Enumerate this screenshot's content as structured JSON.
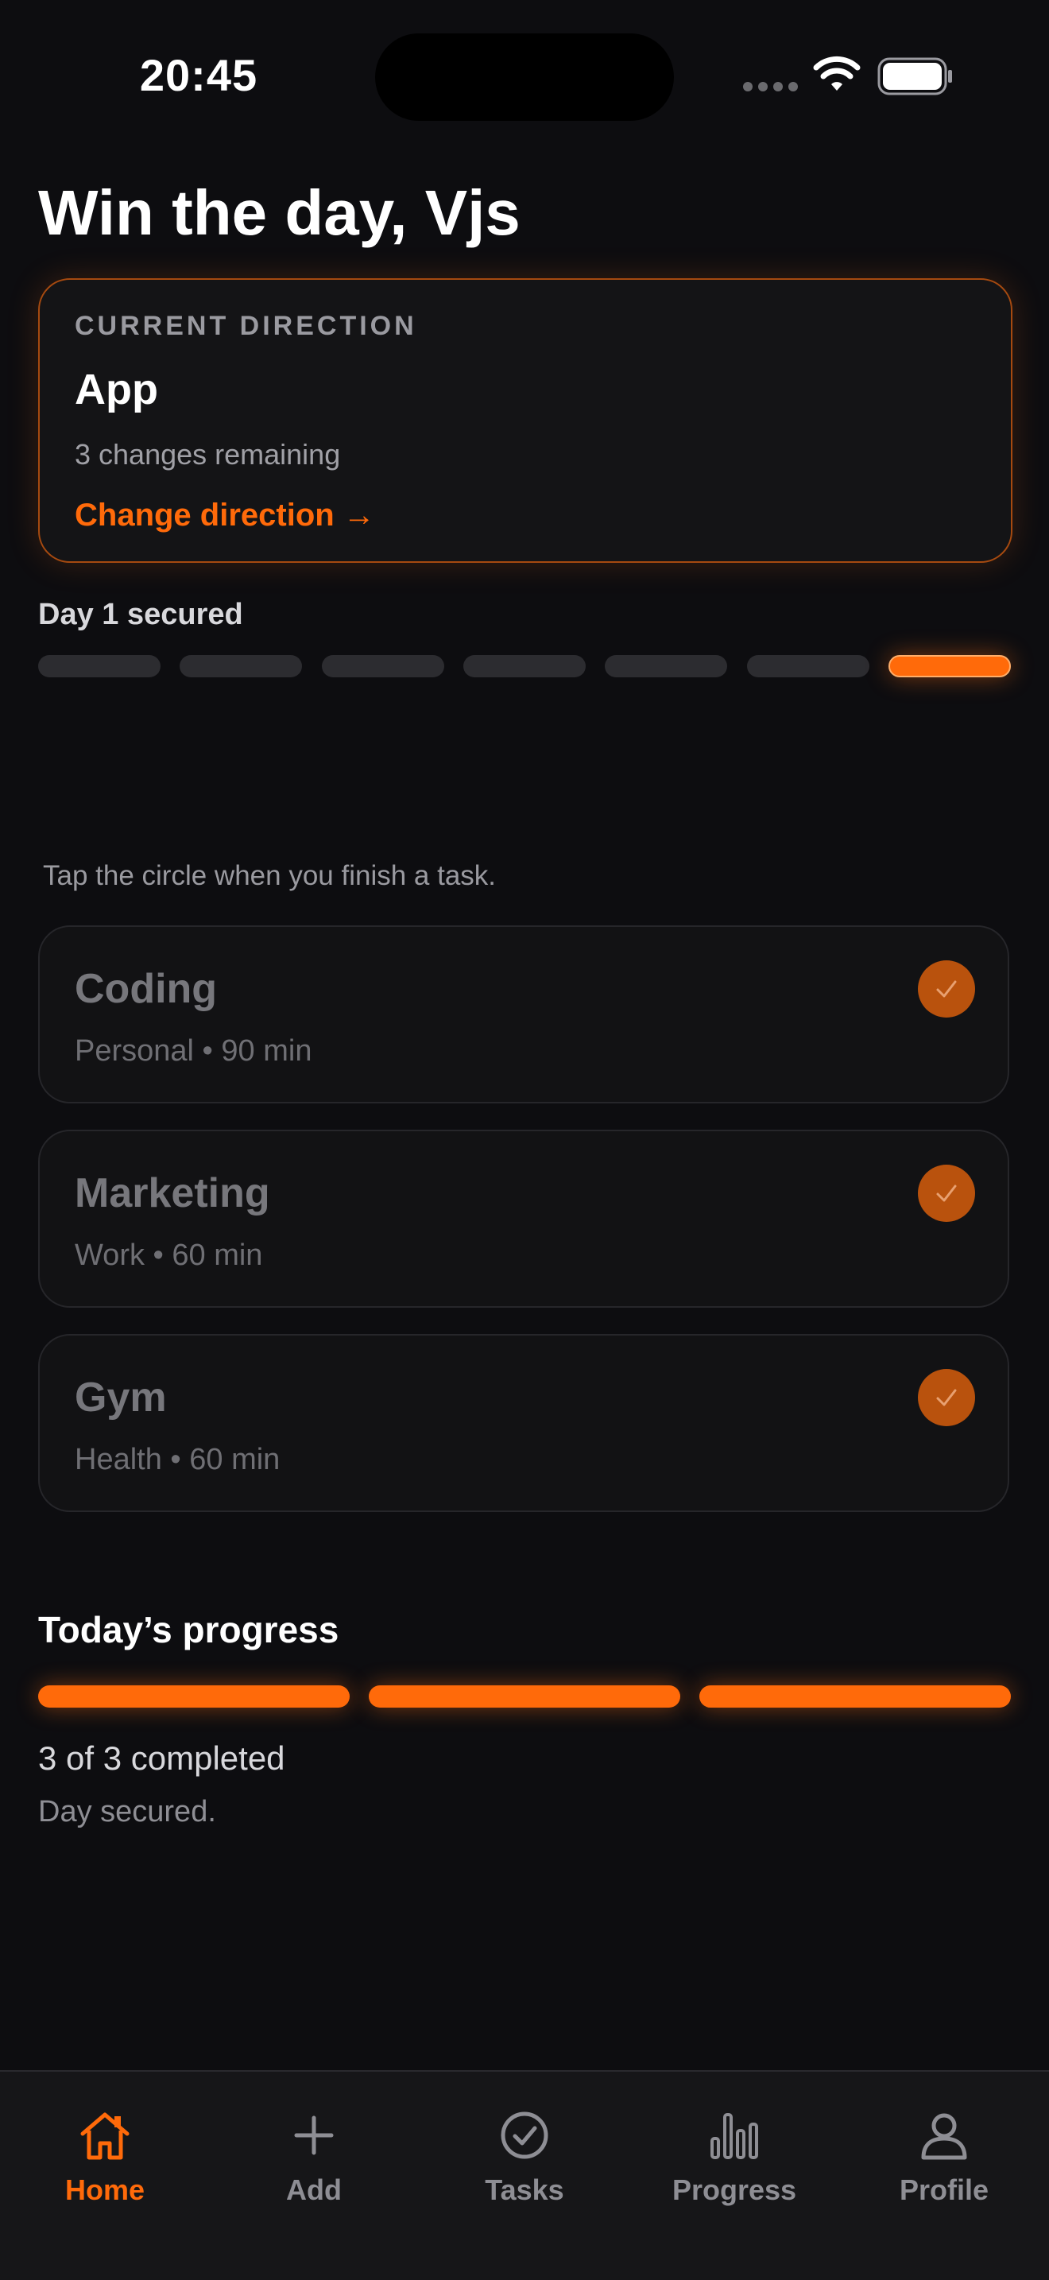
{
  "status_bar": {
    "time": "20:45"
  },
  "header": {
    "greeting": "Win the day, Vjs"
  },
  "direction": {
    "label": "CURRENT DIRECTION",
    "value": "App",
    "remaining": "3 changes remaining",
    "change_label": "Change direction →"
  },
  "streak": {
    "label": "Day 1 secured",
    "days_total": 7,
    "active_index": 6
  },
  "hint": "Tap the circle when you finish a task.",
  "tasks": [
    {
      "title": "Coding",
      "meta": "Personal • 90 min",
      "completed": true
    },
    {
      "title": "Marketing",
      "meta": "Work • 60 min",
      "completed": true
    },
    {
      "title": "Gym",
      "meta": "Health • 60 min",
      "completed": true
    }
  ],
  "progress": {
    "title": "Today’s progress",
    "completed": 3,
    "total": 3,
    "count_text": "3 of 3 completed",
    "status": "Day secured."
  },
  "tabbar": {
    "items": [
      {
        "label": "Home",
        "icon": "home-icon",
        "active": true
      },
      {
        "label": "Add",
        "icon": "plus-icon",
        "active": false
      },
      {
        "label": "Tasks",
        "icon": "check-circle-icon",
        "active": false
      },
      {
        "label": "Progress",
        "icon": "bar-chart-icon",
        "active": false
      },
      {
        "label": "Profile",
        "icon": "person-icon",
        "active": false
      }
    ]
  },
  "colors": {
    "accent": "#ff6a0a",
    "background": "#0d0d10",
    "card": "#141416",
    "check": "#b9520d"
  }
}
